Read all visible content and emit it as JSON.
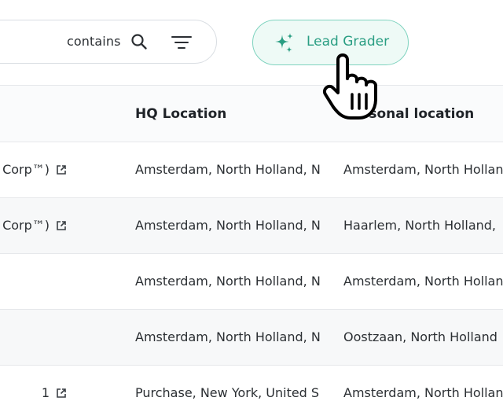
{
  "toolbar": {
    "filter_operator": "contains",
    "lead_grader_label": "Lead Grader"
  },
  "table": {
    "columns": [
      "HQ Location",
      "Personal location"
    ],
    "rows": [
      {
        "company": "Corp™)",
        "has_link": true,
        "hq": "Amsterdam, North Holland, N",
        "personal": "Amsterdam, North Holland,"
      },
      {
        "company": "Corp™)",
        "has_link": true,
        "hq": "Amsterdam, North Holland, N",
        "personal": "Haarlem, North Holland,"
      },
      {
        "company": "",
        "has_link": false,
        "hq": "Amsterdam, North Holland, N",
        "personal": "Amsterdam, North Holland,"
      },
      {
        "company": "",
        "has_link": false,
        "hq": "Amsterdam, North Holland, N",
        "personal": "Oostzaan, North Holland"
      },
      {
        "company": "1",
        "has_link": true,
        "hq": "Purchase, New York, United S",
        "personal": "Amsterdam, North Holland,"
      }
    ]
  },
  "icons": {
    "search": "search-icon",
    "filter": "filter-lines-icon",
    "sparkle": "sparkle-icon",
    "external_link": "external-link-icon",
    "cursor": "hand-pointer-cursor-icon"
  },
  "colors": {
    "accent": "#2a9e83",
    "accent_border": "#7fd3bf",
    "accent_bg": "#eefaf6",
    "row_alt": "#f7f8f9",
    "border": "#e6e8eb"
  }
}
